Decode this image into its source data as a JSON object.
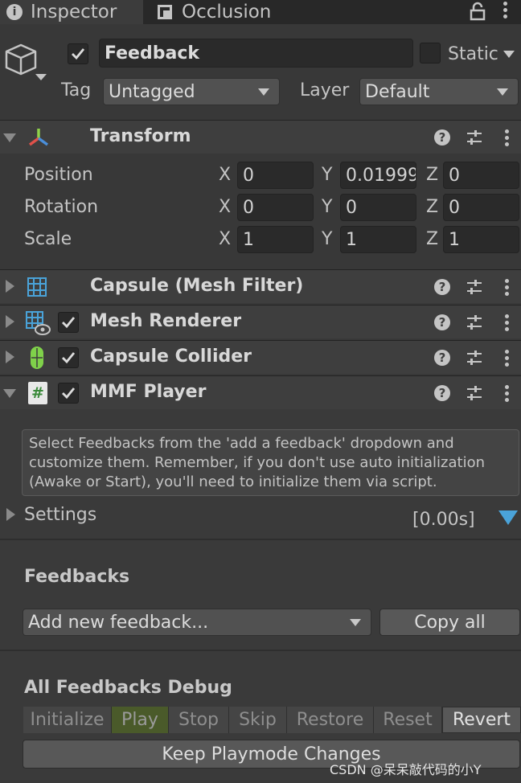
{
  "tabs": [
    {
      "label": "Inspector",
      "icon": "info-icon",
      "active": true
    },
    {
      "label": "Occlusion",
      "icon": "occlusion-icon",
      "active": false
    }
  ],
  "object": {
    "name": "Feedback",
    "active": true,
    "static_label": "Static",
    "tag_label": "Tag",
    "tag_value": "Untagged",
    "layer_label": "Layer",
    "layer_value": "Default"
  },
  "transform": {
    "title": "Transform",
    "rows": [
      {
        "label": "Position",
        "x": "0",
        "y": "0.01999",
        "z": "0"
      },
      {
        "label": "Rotation",
        "x": "0",
        "y": "0",
        "z": "0"
      },
      {
        "label": "Scale",
        "x": "1",
        "y": "1",
        "z": "1"
      }
    ],
    "axis": {
      "x": "X",
      "y": "Y",
      "z": "Z"
    }
  },
  "components": [
    {
      "title": "Capsule (Mesh Filter)",
      "icon": "mesh-filter-icon",
      "checkbox": false
    },
    {
      "title": "Mesh Renderer",
      "icon": "mesh-renderer-icon",
      "checkbox": true
    },
    {
      "title": "Capsule Collider",
      "icon": "capsule-collider-icon",
      "checkbox": true
    },
    {
      "title": "MMF Player",
      "icon": "script-icon",
      "checkbox": true
    }
  ],
  "mmf": {
    "help_text": "Select Feedbacks from the 'add a feedback' dropdown and customize them. Remember, if you don't use auto initialization (Awake or Start), you'll need to initialize them via script.",
    "settings_label": "Settings",
    "settings_time": "[0.00s]",
    "feedbacks_heading": "Feedbacks",
    "add_feedback": "Add new feedback...",
    "copy_all": "Copy all",
    "debug_heading": "All Feedbacks Debug",
    "debug_buttons": [
      "Initialize",
      "Play",
      "Stop",
      "Skip",
      "Restore",
      "Reset",
      "Revert"
    ],
    "keep_changes": "Keep Playmode Changes"
  },
  "watermark": "CSDN @呆呆敲代码的小Y",
  "colors": {
    "accent_blue": "#4aa3d9",
    "play_green": "#4a5a2a",
    "collider_green": "#7fd14a",
    "transform_red": "#e0514a",
    "transform_green": "#8fd14a",
    "transform_blue": "#4a8ed9"
  }
}
